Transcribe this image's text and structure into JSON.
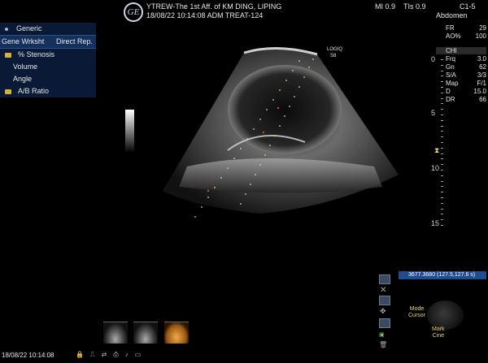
{
  "header": {
    "logo_text": "GE",
    "line1": "YTREW-The 1st Aff. of KM DING, LIPING",
    "line2": "18/08/22 10:14:08    ADM  TREAT-124",
    "mi": "MI 0.9",
    "tis": "TIs 0.9",
    "probe": "C1-5",
    "preset": "Abdomen"
  },
  "menu": {
    "title": "Generic",
    "tab_left": "Gene Wrksht",
    "tab_right": "Direct Rep.",
    "items": [
      {
        "label": "% Stenosis",
        "folder": true
      },
      {
        "label": "Volume",
        "folder": false
      },
      {
        "label": "Angle",
        "folder": false
      },
      {
        "label": "A/B Ratio",
        "folder": true
      }
    ]
  },
  "params": {
    "top": [
      {
        "k": "FR",
        "v": "29"
      },
      {
        "k": "AO%",
        "v": "100"
      }
    ],
    "chi_label": "CHI",
    "chi": [
      {
        "k": "Frq",
        "v": "3.0"
      },
      {
        "k": "Gn",
        "v": "62"
      },
      {
        "k": "S/A",
        "v": "3/3"
      },
      {
        "k": "Map",
        "v": "F/1"
      },
      {
        "k": "D",
        "v": "15.0"
      },
      {
        "k": "DR",
        "v": "66"
      }
    ]
  },
  "depth": {
    "labels": [
      "0",
      "5",
      "10",
      "15"
    ],
    "focus_marker": "⧗"
  },
  "image_labels": {
    "brand": "LOGIQ",
    "model": "S8"
  },
  "coord_box": "3677.3680  (127.5,127.6 s)",
  "trackball": {
    "left_label_1": "Mode",
    "left_label_2": "Cursor",
    "bottom_label_1": "Mark",
    "bottom_label_2": "Cine"
  },
  "footer": {
    "timestamp": "18/08/22 10:14:08"
  },
  "colors": {
    "accent_yellow": "#e8d77a",
    "menu_blue": "#14305c",
    "coord_blue": "#1f4d8c"
  }
}
